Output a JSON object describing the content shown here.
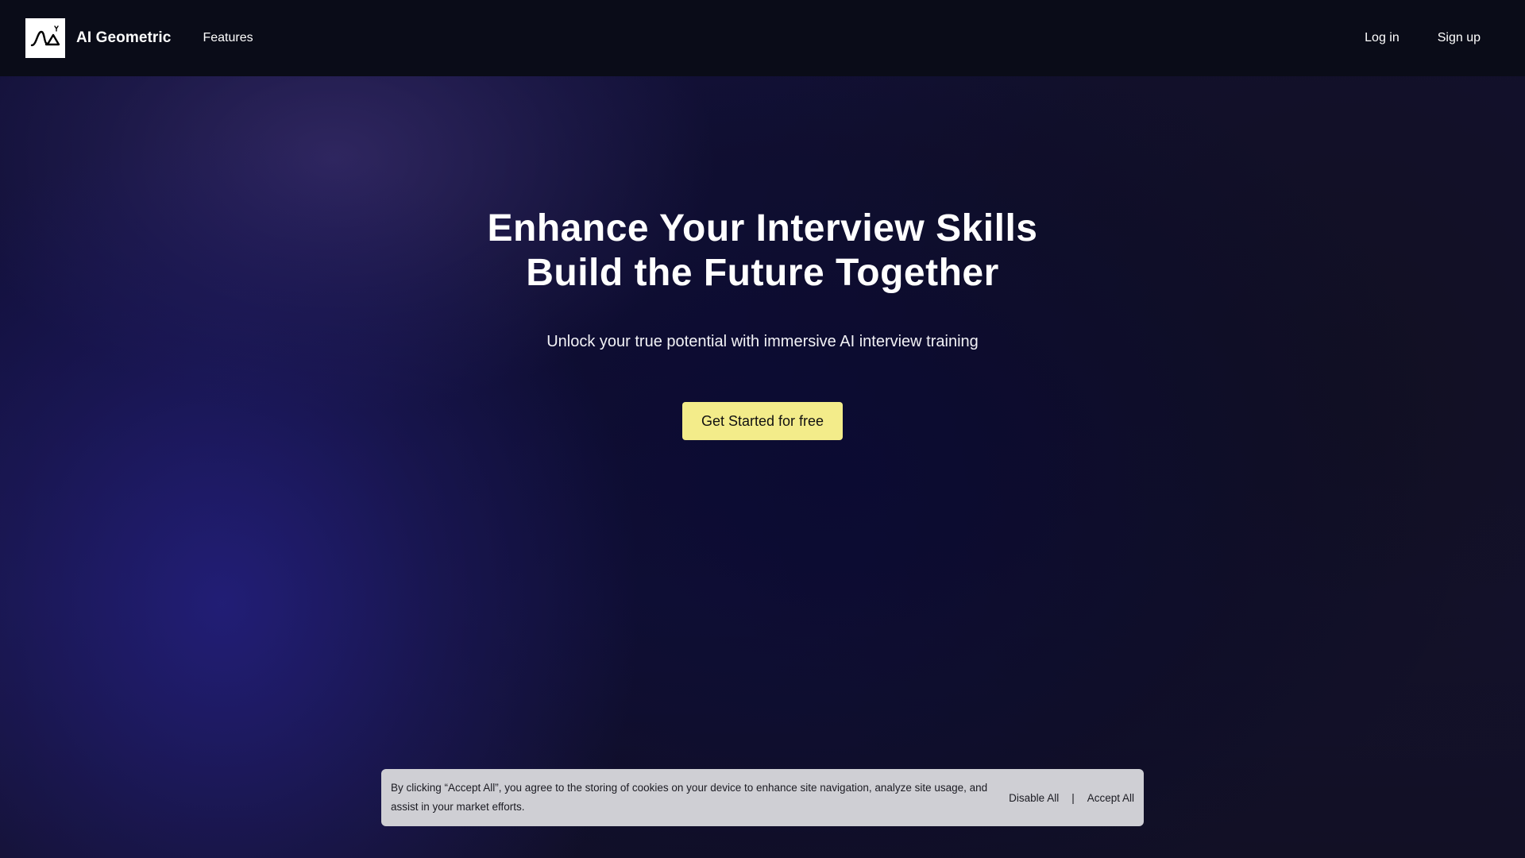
{
  "navbar": {
    "brand": "AI Geometric",
    "logo_icon": "ai-geometric-logo-icon",
    "links": {
      "features": "Features"
    },
    "auth": {
      "login": "Log in",
      "signup": "Sign up"
    }
  },
  "hero": {
    "title_line1": "Enhance Your Interview Skills",
    "title_line2": "Build the Future Together",
    "subtitle": "Unlock your true potential with immersive AI interview training",
    "cta_label": "Get Started for free"
  },
  "cookie_banner": {
    "text": "By clicking “Accept All”, you agree to the storing of cookies on your device to enhance site navigation, analyze site usage, and assist in your market efforts.",
    "disable_label": "Disable All",
    "separator": "|",
    "accept_label": "Accept All"
  },
  "colors": {
    "navbar_bg": "#0a0c18",
    "cta_bg": "#f3ec8a",
    "cookie_bg": "#cfcfd4",
    "background_accent": "#1e1a64"
  }
}
